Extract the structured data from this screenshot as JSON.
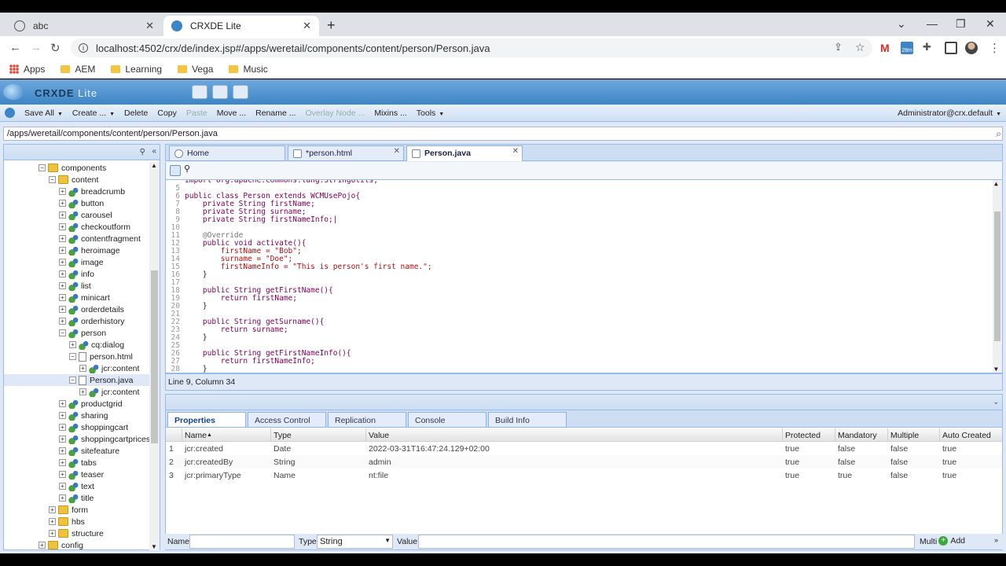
{
  "browser": {
    "tabs": [
      {
        "title": "abc",
        "active": false
      },
      {
        "title": "CRXDE Lite",
        "active": true
      }
    ],
    "url": "localhost:4502/crx/de/index.jsp#/apps/weretail/components/content/person/Person.java",
    "bookmarks": [
      "Apps",
      "AEM",
      "Learning",
      "Vega",
      "Music"
    ],
    "ext_badge": "28m"
  },
  "app": {
    "name_bold": "CRXDE",
    "name_light": "Lite",
    "menu": [
      "Save All",
      "Create ...",
      "Delete",
      "Copy",
      "Paste",
      "Move ...",
      "Rename ...",
      "Overlay Node ...",
      "Mixins ...",
      "Tools"
    ],
    "user": "Administrator@crx.default",
    "path": "/apps/weretail/components/content/person/Person.java"
  },
  "tree": [
    {
      "label": "components",
      "indent": 1,
      "type": "folder",
      "toggle": "−"
    },
    {
      "label": "content",
      "indent": 2,
      "type": "folder",
      "toggle": "−"
    },
    {
      "label": "breadcrumb",
      "indent": 3,
      "type": "node",
      "toggle": "+"
    },
    {
      "label": "button",
      "indent": 3,
      "type": "node",
      "toggle": "+"
    },
    {
      "label": "carousel",
      "indent": 3,
      "type": "node",
      "toggle": "+"
    },
    {
      "label": "checkoutform",
      "indent": 3,
      "type": "node",
      "toggle": "+"
    },
    {
      "label": "contentfragment",
      "indent": 3,
      "type": "node",
      "toggle": "+"
    },
    {
      "label": "heroimage",
      "indent": 3,
      "type": "node",
      "toggle": "+"
    },
    {
      "label": "image",
      "indent": 3,
      "type": "node",
      "toggle": "+"
    },
    {
      "label": "info",
      "indent": 3,
      "type": "node",
      "toggle": "+"
    },
    {
      "label": "list",
      "indent": 3,
      "type": "node",
      "toggle": "+"
    },
    {
      "label": "minicart",
      "indent": 3,
      "type": "node",
      "toggle": "+"
    },
    {
      "label": "orderdetails",
      "indent": 3,
      "type": "node",
      "toggle": "+"
    },
    {
      "label": "orderhistory",
      "indent": 3,
      "type": "node",
      "toggle": "+"
    },
    {
      "label": "person",
      "indent": 3,
      "type": "node",
      "toggle": "−"
    },
    {
      "label": "cq:dialog",
      "indent": 4,
      "type": "node",
      "toggle": "+"
    },
    {
      "label": "person.html",
      "indent": 4,
      "type": "file",
      "toggle": "−"
    },
    {
      "label": "jcr:content",
      "indent": 5,
      "type": "node",
      "toggle": "+"
    },
    {
      "label": "Person.java",
      "indent": 4,
      "type": "file",
      "toggle": "−",
      "selected": true
    },
    {
      "label": "jcr:content",
      "indent": 5,
      "type": "node",
      "toggle": "+"
    },
    {
      "label": "productgrid",
      "indent": 3,
      "type": "node",
      "toggle": "+"
    },
    {
      "label": "sharing",
      "indent": 3,
      "type": "node",
      "toggle": "+"
    },
    {
      "label": "shoppingcart",
      "indent": 3,
      "type": "node",
      "toggle": "+"
    },
    {
      "label": "shoppingcartprices",
      "indent": 3,
      "type": "node",
      "toggle": "+"
    },
    {
      "label": "sitefeature",
      "indent": 3,
      "type": "node",
      "toggle": "+"
    },
    {
      "label": "tabs",
      "indent": 3,
      "type": "node",
      "toggle": "+"
    },
    {
      "label": "teaser",
      "indent": 3,
      "type": "node",
      "toggle": "+"
    },
    {
      "label": "text",
      "indent": 3,
      "type": "node",
      "toggle": "+"
    },
    {
      "label": "title",
      "indent": 3,
      "type": "node",
      "toggle": "+"
    },
    {
      "label": "form",
      "indent": 2,
      "type": "folder",
      "toggle": "+"
    },
    {
      "label": "hbs",
      "indent": 2,
      "type": "folder",
      "toggle": "+"
    },
    {
      "label": "structure",
      "indent": 2,
      "type": "folder",
      "toggle": "+"
    },
    {
      "label": "config",
      "indent": 1,
      "type": "folder",
      "toggle": "+"
    }
  ],
  "editor": {
    "tabs": [
      {
        "label": "Home",
        "closable": false
      },
      {
        "label": "*person.html",
        "closable": true
      },
      {
        "label": "Person.java",
        "closable": true,
        "active": true
      }
    ],
    "code": [
      {
        "n": "",
        "text": "import org.apache.commons.lang.StringUtils;"
      },
      {
        "n": "5",
        "text": ""
      },
      {
        "n": "6",
        "text": "public class Person extends WCMUsePojo{"
      },
      {
        "n": "7",
        "text": "    private String firstName;"
      },
      {
        "n": "8",
        "text": "    private String surname;"
      },
      {
        "n": "9",
        "text": "    private String firstNameInfo;|"
      },
      {
        "n": "10",
        "text": ""
      },
      {
        "n": "11",
        "text": "    @Override"
      },
      {
        "n": "12",
        "text": "    public void activate(){"
      },
      {
        "n": "13",
        "text": "        firstName = \"Bob\";"
      },
      {
        "n": "14",
        "text": "        surname = \"Doe\";"
      },
      {
        "n": "15",
        "text": "        firstNameInfo = \"This is person's first name.\";"
      },
      {
        "n": "16",
        "text": "    }"
      },
      {
        "n": "17",
        "text": ""
      },
      {
        "n": "18",
        "text": "    public String getFirstName(){"
      },
      {
        "n": "19",
        "text": "        return firstName;"
      },
      {
        "n": "20",
        "text": "    }"
      },
      {
        "n": "21",
        "text": ""
      },
      {
        "n": "22",
        "text": "    public String getSurname(){"
      },
      {
        "n": "23",
        "text": "        return surname;"
      },
      {
        "n": "24",
        "text": "    }"
      },
      {
        "n": "25",
        "text": ""
      },
      {
        "n": "26",
        "text": "    public String getFirstNameInfo(){"
      },
      {
        "n": "27",
        "text": "        return firstNameInfo;"
      },
      {
        "n": "28",
        "text": "    }"
      }
    ],
    "status": "Line 9, Column 34"
  },
  "properties": {
    "tabs": [
      "Properties",
      "Access Control",
      "Replication",
      "Console",
      "Build Info"
    ],
    "columns": [
      "Name",
      "Type",
      "Value",
      "Protected",
      "Mandatory",
      "Multiple",
      "Auto Created"
    ],
    "rows": [
      [
        "1",
        "jcr:created",
        "Date",
        "2022-03-31T16:47:24.129+02:00",
        "true",
        "false",
        "false",
        "true"
      ],
      [
        "2",
        "jcr:createdBy",
        "String",
        "admin",
        "true",
        "false",
        "false",
        "true"
      ],
      [
        "3",
        "jcr:primaryType",
        "Name",
        "nt:file",
        "true",
        "true",
        "false",
        "true"
      ]
    ],
    "add": {
      "name_label": "Name",
      "type_label": "Type",
      "type_value": "String",
      "value_label": "Value",
      "multi_label": "Multi",
      "add_label": "Add"
    }
  }
}
